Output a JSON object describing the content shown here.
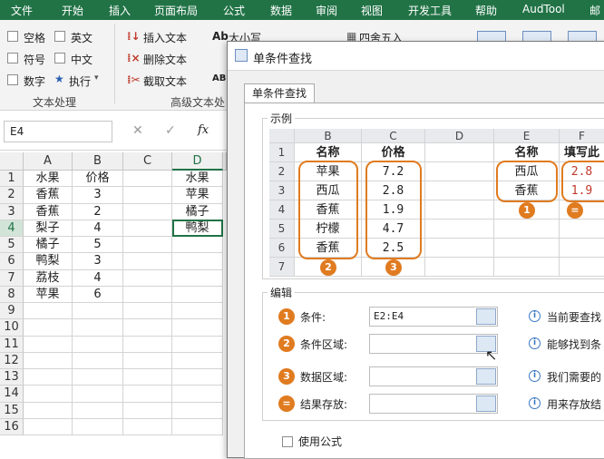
{
  "ribbon_tabs": [
    "文件",
    "开始",
    "插入",
    "页面布局",
    "公式",
    "数据",
    "审阅",
    "视图",
    "开发工具",
    "帮助",
    "AudTool",
    "邮"
  ],
  "ribbon": {
    "checkboxes": [
      "空格",
      "英文",
      "符号",
      "中文",
      "数字"
    ],
    "exec_label": "执行",
    "group_text_process": "文本处理",
    "group_advanced": "高级文本处",
    "insert_text": "插入文本",
    "delete_text": "删除文本",
    "extract_text": "截取文本",
    "case_label": "大小写",
    "round_label": "四舍五入"
  },
  "formula_bar": {
    "name_box": "E4",
    "cancel": "✕",
    "confirm": "✓",
    "fx": "fx"
  },
  "sheet": {
    "col_headers": [
      "A",
      "B",
      "C",
      "D",
      "E"
    ],
    "row_headers": [
      "1",
      "2",
      "3",
      "4",
      "5",
      "6",
      "7",
      "8",
      "9",
      "10",
      "11",
      "12",
      "13",
      "14",
      "15",
      "16"
    ],
    "colA": [
      "水果",
      "香蕉",
      "香蕉",
      "梨子",
      "橘子",
      "鸭梨",
      "荔枝",
      "苹果"
    ],
    "colB": [
      "价格",
      "3",
      "2",
      "4",
      "5",
      "3",
      "4",
      "6"
    ],
    "colE": [
      "水果",
      "苹果",
      "橘子",
      "鸭梨"
    ]
  },
  "dialog": {
    "title": "单条件查找",
    "tab": "单条件查找",
    "example_label": "示例",
    "example_cols": [
      "B",
      "C",
      "D",
      "E",
      "F"
    ],
    "example_rows": [
      "1",
      "2",
      "3",
      "4",
      "5",
      "6",
      "7"
    ],
    "example_headers": {
      "name": "名称",
      "price": "价格",
      "e_name": "名称",
      "f_fill": "填写此"
    },
    "example_names": [
      "苹果",
      "西瓜",
      "香蕉",
      "柠檬",
      "香蕉"
    ],
    "example_prices": [
      "7.2",
      "2.8",
      "1.9",
      "4.7",
      "2.5"
    ],
    "example_lookup": [
      "西瓜",
      "香蕉"
    ],
    "example_results": [
      "2.8",
      "1.9"
    ],
    "badges": [
      "2",
      "3",
      "1",
      "="
    ],
    "edit_label": "编辑",
    "fields": [
      {
        "badge": "1",
        "label": "条件:",
        "value": "E2:E4",
        "hint": "当前要查找"
      },
      {
        "badge": "2",
        "label": "条件区域:",
        "value": "",
        "hint": "能够找到条"
      },
      {
        "badge": "3",
        "label": "数据区域:",
        "value": "",
        "hint": "我们需要的"
      },
      {
        "badge": "=",
        "label": "结果存放:",
        "value": "",
        "hint": "用来存放结"
      }
    ],
    "use_formula": "使用公式"
  },
  "colors": {
    "excel_green": "#217346",
    "accent_orange": "#e07b20",
    "result_red": "#c0392b"
  }
}
